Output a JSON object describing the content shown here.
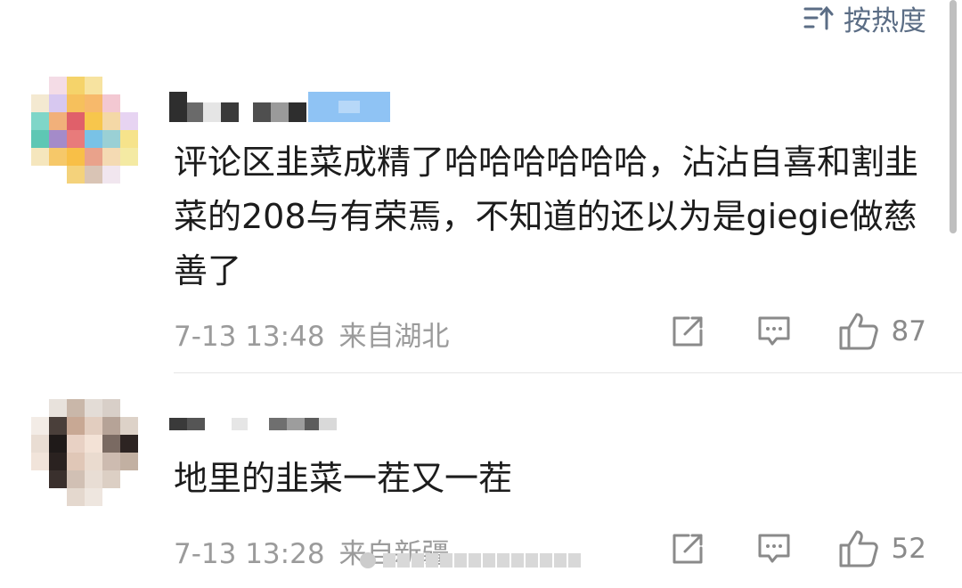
{
  "sort": {
    "label": "按热度",
    "icon": "sort-icon"
  },
  "comments": [
    {
      "text": "评论区韭菜成精了哈哈哈哈哈哈，沾沾自喜和割韭菜的208与有荣焉，不知道的还以为是giegie做慈善了",
      "time": "7-13 13:48",
      "location": "来自湖北",
      "likes": "87"
    },
    {
      "text": "地里的韭菜一茬又一茬",
      "time": "7-13 13:28",
      "location": "来自新疆",
      "likes": "52"
    }
  ],
  "icons": {
    "share": "share-icon",
    "reply": "comment-icon",
    "like": "thumbs-up-icon"
  },
  "colors": {
    "sort_text": "#5b6d85",
    "meta_text": "#9b9b9b",
    "body_text": "#1c1c1c",
    "badge": "#8fc3f4"
  }
}
